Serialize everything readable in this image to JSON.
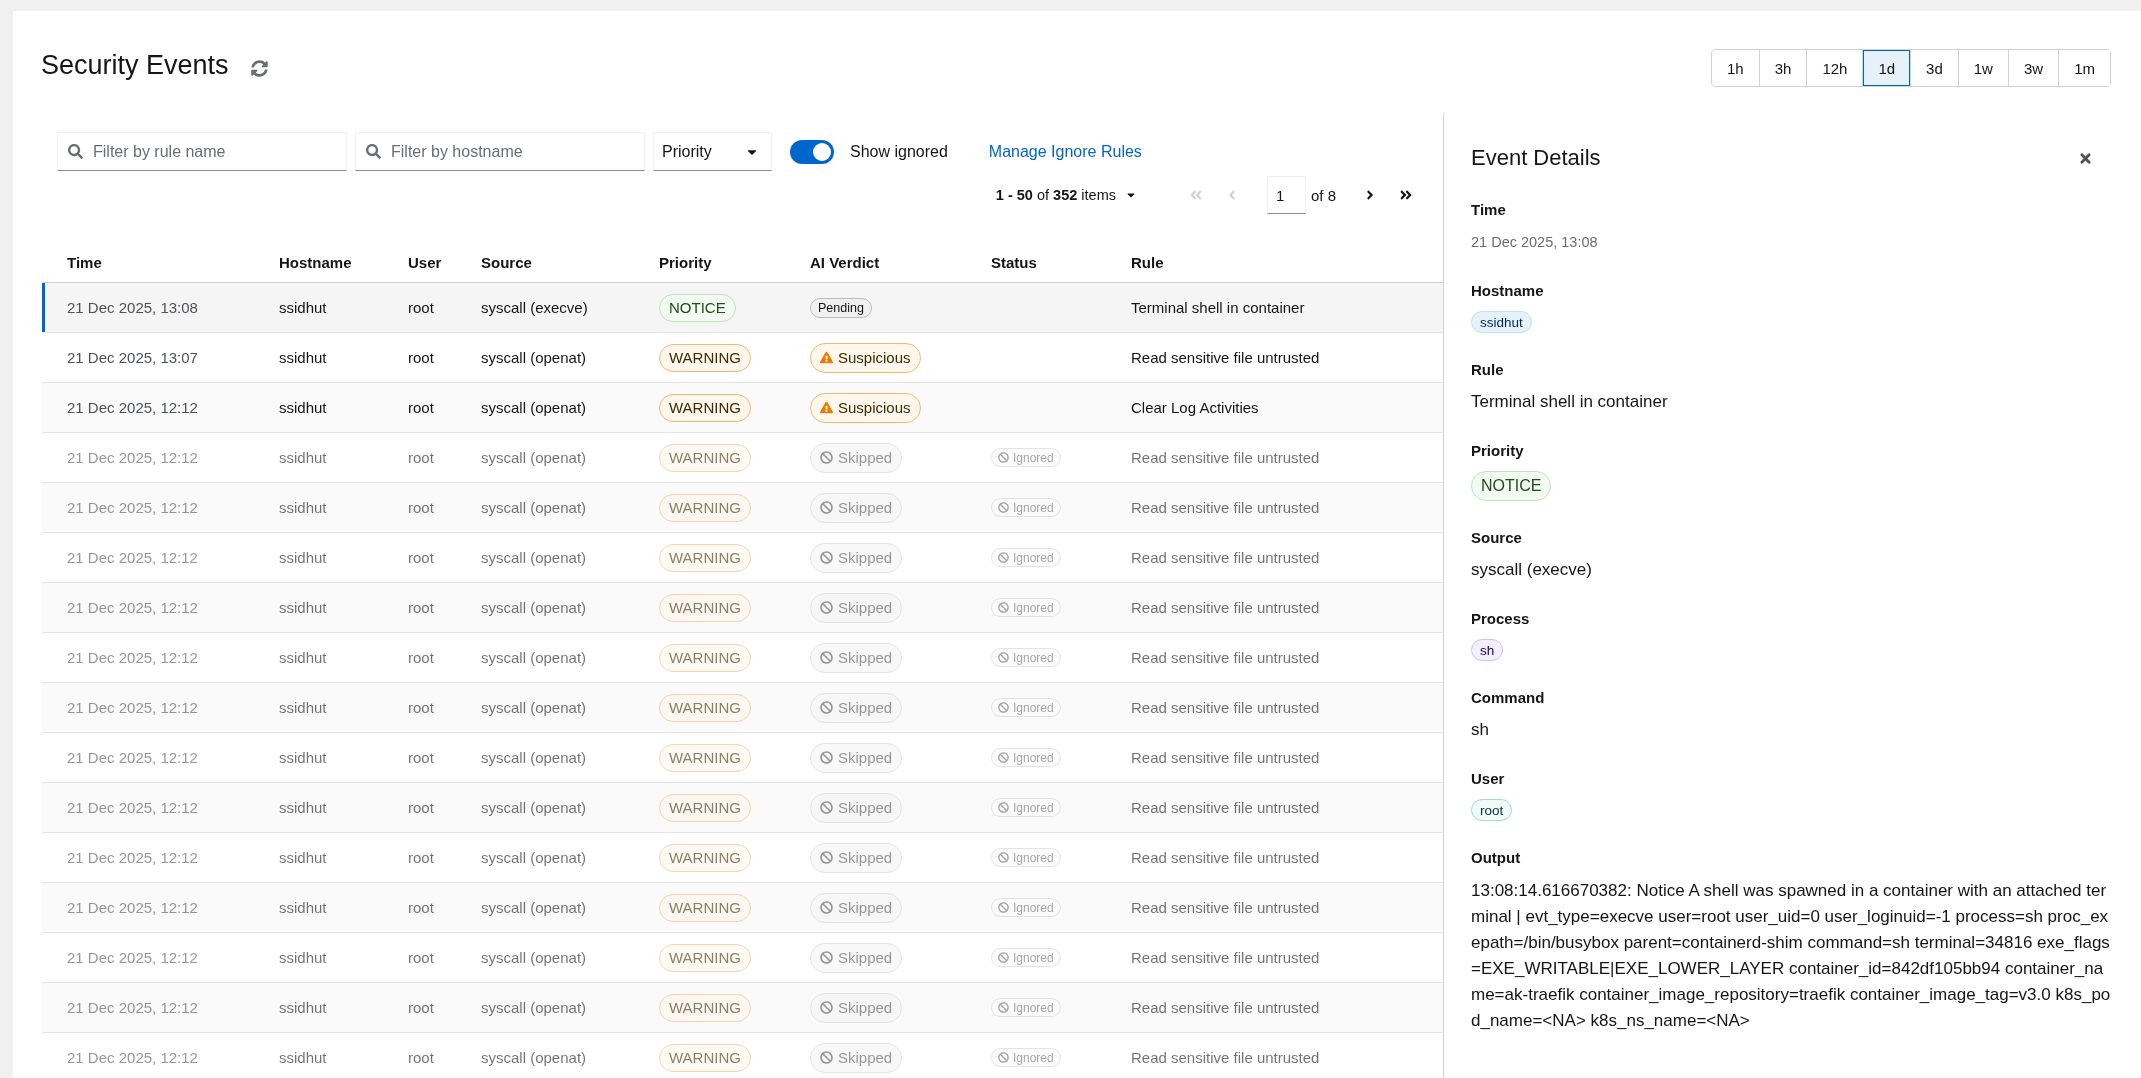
{
  "page": {
    "title": "Security Events"
  },
  "ranges": [
    {
      "label": "1h",
      "selected": false
    },
    {
      "label": "3h",
      "selected": false
    },
    {
      "label": "12h",
      "selected": false
    },
    {
      "label": "1d",
      "selected": true
    },
    {
      "label": "3d",
      "selected": false
    },
    {
      "label": "1w",
      "selected": false
    },
    {
      "label": "3w",
      "selected": false
    },
    {
      "label": "1m",
      "selected": false
    }
  ],
  "filters": {
    "fields": [
      {
        "placeholder": "Filter by rule name"
      },
      {
        "placeholder": "Filter by hostname"
      }
    ],
    "priority_select": {
      "label": "Priority"
    },
    "show_ignored": {
      "label": "Show ignored",
      "on": true
    },
    "manage_link": "Manage Ignore Rules"
  },
  "pagination": {
    "range": "**1 - 50** of **352** items",
    "nav_back": [
      {
        "kind": "first",
        "disabled": true
      },
      {
        "kind": "prev",
        "disabled": true
      }
    ],
    "page": "1",
    "page_count": "of 8",
    "nav_forward": [
      {
        "kind": "next",
        "disabled": false
      },
      {
        "kind": "last",
        "disabled": false
      }
    ]
  },
  "table": {
    "columns": [
      "Time",
      "Hostname",
      "User",
      "Source",
      "Priority",
      "AI Verdict",
      "Status",
      "Rule"
    ],
    "rows": [
      {
        "time": "21 Dec 2025, 13:08",
        "hostname": "ssidhut",
        "user": "root",
        "source": "syscall (execve)",
        "priority": {
          "label": "NOTICE",
          "kind": "notice"
        },
        "verdict": {
          "label": "Pending",
          "kind": "pending"
        },
        "rule": "Terminal shell in container",
        "selected": true,
        "ignored": false
      },
      {
        "time": "21 Dec 2025, 13:07",
        "hostname": "ssidhut",
        "user": "root",
        "source": "syscall (openat)",
        "priority": {
          "label": "WARNING",
          "kind": "warning"
        },
        "verdict": {
          "label": "Suspicious",
          "kind": "suspicious"
        },
        "rule": "Read sensitive file untrusted",
        "selected": false,
        "ignored": false
      },
      {
        "time": "21 Dec 2025, 12:12",
        "hostname": "ssidhut",
        "user": "root",
        "source": "syscall (openat)",
        "priority": {
          "label": "WARNING",
          "kind": "warning"
        },
        "verdict": {
          "label": "Suspicious",
          "kind": "suspicious"
        },
        "rule": "Clear Log Activities",
        "selected": false,
        "ignored": false
      },
      {
        "time": "21 Dec 2025, 12:12",
        "hostname": "ssidhut",
        "user": "root",
        "source": "syscall (openat)",
        "priority": {
          "label": "WARNING",
          "kind": "warning"
        },
        "verdict": {
          "label": "Skipped",
          "kind": "skipped"
        },
        "status": "Ignored",
        "rule": "Read sensitive file untrusted",
        "selected": false,
        "ignored": true
      },
      {
        "time": "21 Dec 2025, 12:12",
        "hostname": "ssidhut",
        "user": "root",
        "source": "syscall (openat)",
        "priority": {
          "label": "WARNING",
          "kind": "warning"
        },
        "verdict": {
          "label": "Skipped",
          "kind": "skipped"
        },
        "status": "Ignored",
        "rule": "Read sensitive file untrusted",
        "selected": false,
        "ignored": true
      },
      {
        "time": "21 Dec 2025, 12:12",
        "hostname": "ssidhut",
        "user": "root",
        "source": "syscall (openat)",
        "priority": {
          "label": "WARNING",
          "kind": "warning"
        },
        "verdict": {
          "label": "Skipped",
          "kind": "skipped"
        },
        "status": "Ignored",
        "rule": "Read sensitive file untrusted",
        "selected": false,
        "ignored": true
      },
      {
        "time": "21 Dec 2025, 12:12",
        "hostname": "ssidhut",
        "user": "root",
        "source": "syscall (openat)",
        "priority": {
          "label": "WARNING",
          "kind": "warning"
        },
        "verdict": {
          "label": "Skipped",
          "kind": "skipped"
        },
        "status": "Ignored",
        "rule": "Read sensitive file untrusted",
        "selected": false,
        "ignored": true
      },
      {
        "time": "21 Dec 2025, 12:12",
        "hostname": "ssidhut",
        "user": "root",
        "source": "syscall (openat)",
        "priority": {
          "label": "WARNING",
          "kind": "warning"
        },
        "verdict": {
          "label": "Skipped",
          "kind": "skipped"
        },
        "status": "Ignored",
        "rule": "Read sensitive file untrusted",
        "selected": false,
        "ignored": true
      },
      {
        "time": "21 Dec 2025, 12:12",
        "hostname": "ssidhut",
        "user": "root",
        "source": "syscall (openat)",
        "priority": {
          "label": "WARNING",
          "kind": "warning"
        },
        "verdict": {
          "label": "Skipped",
          "kind": "skipped"
        },
        "status": "Ignored",
        "rule": "Read sensitive file untrusted",
        "selected": false,
        "ignored": true
      },
      {
        "time": "21 Dec 2025, 12:12",
        "hostname": "ssidhut",
        "user": "root",
        "source": "syscall (openat)",
        "priority": {
          "label": "WARNING",
          "kind": "warning"
        },
        "verdict": {
          "label": "Skipped",
          "kind": "skipped"
        },
        "status": "Ignored",
        "rule": "Read sensitive file untrusted",
        "selected": false,
        "ignored": true
      },
      {
        "time": "21 Dec 2025, 12:12",
        "hostname": "ssidhut",
        "user": "root",
        "source": "syscall (openat)",
        "priority": {
          "label": "WARNING",
          "kind": "warning"
        },
        "verdict": {
          "label": "Skipped",
          "kind": "skipped"
        },
        "status": "Ignored",
        "rule": "Read sensitive file untrusted",
        "selected": false,
        "ignored": true
      },
      {
        "time": "21 Dec 2025, 12:12",
        "hostname": "ssidhut",
        "user": "root",
        "source": "syscall (openat)",
        "priority": {
          "label": "WARNING",
          "kind": "warning"
        },
        "verdict": {
          "label": "Skipped",
          "kind": "skipped"
        },
        "status": "Ignored",
        "rule": "Read sensitive file untrusted",
        "selected": false,
        "ignored": true
      },
      {
        "time": "21 Dec 2025, 12:12",
        "hostname": "ssidhut",
        "user": "root",
        "source": "syscall (openat)",
        "priority": {
          "label": "WARNING",
          "kind": "warning"
        },
        "verdict": {
          "label": "Skipped",
          "kind": "skipped"
        },
        "status": "Ignored",
        "rule": "Read sensitive file untrusted",
        "selected": false,
        "ignored": true
      },
      {
        "time": "21 Dec 2025, 12:12",
        "hostname": "ssidhut",
        "user": "root",
        "source": "syscall (openat)",
        "priority": {
          "label": "WARNING",
          "kind": "warning"
        },
        "verdict": {
          "label": "Skipped",
          "kind": "skipped"
        },
        "status": "Ignored",
        "rule": "Read sensitive file untrusted",
        "selected": false,
        "ignored": true
      },
      {
        "time": "21 Dec 2025, 12:12",
        "hostname": "ssidhut",
        "user": "root",
        "source": "syscall (openat)",
        "priority": {
          "label": "WARNING",
          "kind": "warning"
        },
        "verdict": {
          "label": "Skipped",
          "kind": "skipped"
        },
        "status": "Ignored",
        "rule": "Read sensitive file untrusted",
        "selected": false,
        "ignored": true
      },
      {
        "time": "21 Dec 2025, 12:12",
        "hostname": "ssidhut",
        "user": "root",
        "source": "syscall (openat)",
        "priority": {
          "label": "WARNING",
          "kind": "warning"
        },
        "verdict": {
          "label": "Skipped",
          "kind": "skipped"
        },
        "status": "Ignored",
        "rule": "Read sensitive file untrusted",
        "selected": false,
        "ignored": true
      }
    ]
  },
  "details": {
    "title": "Event Details",
    "fields": [
      {
        "label": "Time",
        "kind": "muted",
        "value": "21 Dec 2025, 13:08"
      },
      {
        "label": "Hostname",
        "kind": "tag",
        "value": "ssidhut",
        "color": "#e7f1fa"
      },
      {
        "label": "Rule",
        "kind": "text",
        "value": "Terminal shell in container"
      },
      {
        "label": "Priority",
        "kind": "priority",
        "badge": {
          "label": "NOTICE",
          "kind": "notice"
        }
      },
      {
        "label": "Source",
        "kind": "text",
        "value": "syscall (execve)"
      },
      {
        "label": "Process",
        "kind": "tag",
        "value": "sh",
        "color": "#f2f0fc"
      },
      {
        "label": "Command",
        "kind": "text",
        "value": "sh"
      },
      {
        "label": "User",
        "kind": "tag",
        "value": "root",
        "color": "#f2f9f9"
      },
      {
        "label": "Output",
        "kind": "output",
        "value": "13:08:14.616670382: Notice A shell was spawned in a container with an attached terminal | evt_type=execve user=root user_uid=0 user_loginuid=-1 process=sh proc_exepath=/bin/busybox parent=containerd-shim command=sh terminal=34816 exe_flags=EXE_WRITABLE|EXE_LOWER_LAYER container_id=842df105bb94 container_name=ak-traefik container_image_repository=traefik container_image_tag=v3.0 k8s_pod_name=<NA> k8s_ns_name=<NA>"
      }
    ]
  }
}
